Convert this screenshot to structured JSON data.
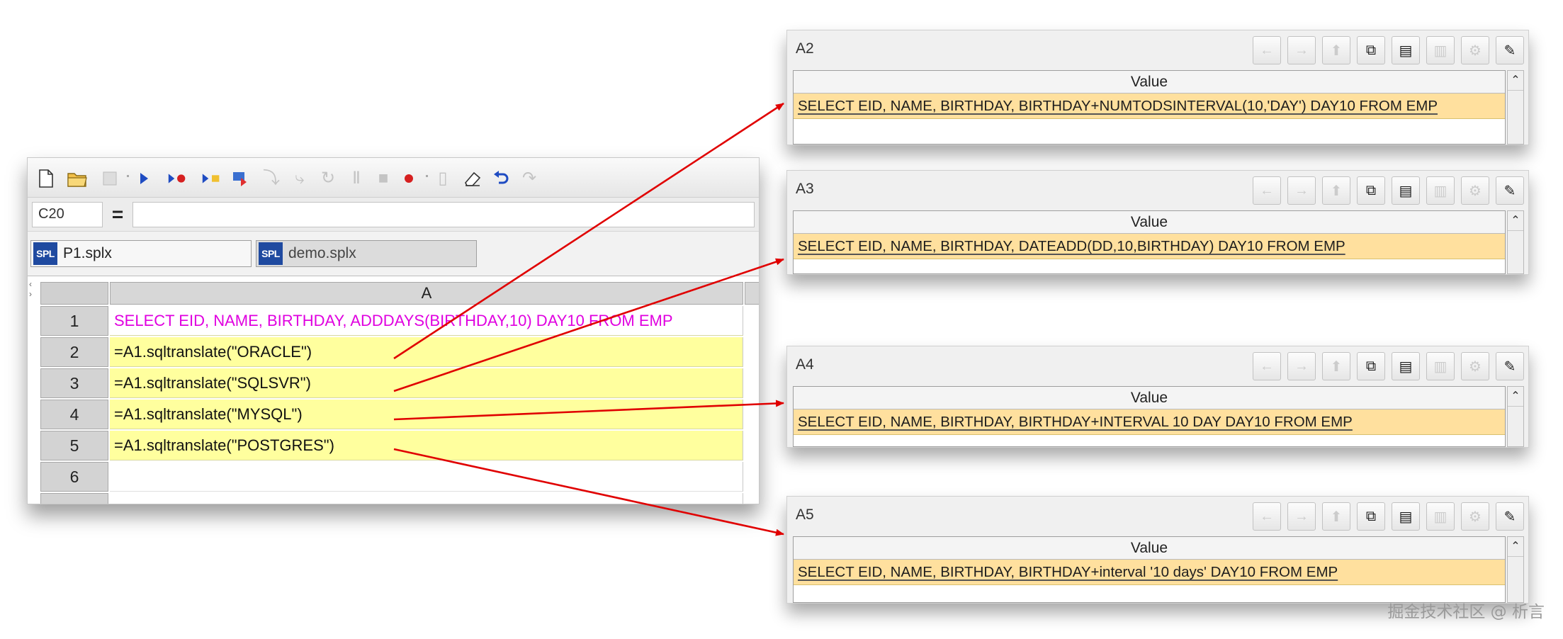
{
  "editor": {
    "cell_ref": "C20",
    "equal_sign": "=",
    "formula": "",
    "tabs": [
      {
        "badge": "SPL",
        "label": "P1.splx"
      },
      {
        "badge": "SPL",
        "label": "demo.splx"
      }
    ],
    "column_header": "A",
    "rows": [
      {
        "num": "1",
        "text": "SELECT EID, NAME, BIRTHDAY, ADDDAYS(BIRTHDAY,10) DAY10 FROM EMP"
      },
      {
        "num": "2",
        "text": "=A1.sqltranslate(\"ORACLE\")"
      },
      {
        "num": "3",
        "text": "=A1.sqltranslate(\"SQLSVR\")"
      },
      {
        "num": "4",
        "text": "=A1.sqltranslate(\"MYSQL\")"
      },
      {
        "num": "5",
        "text": "=A1.sqltranslate(\"POSTGRES\")"
      },
      {
        "num": "6",
        "text": ""
      }
    ]
  },
  "panels": [
    {
      "title": "A2",
      "header": "Value",
      "value": "SELECT EID, NAME, BIRTHDAY, BIRTHDAY+NUMTODSINTERVAL(10,'DAY') DAY10 FROM EMP"
    },
    {
      "title": "A3",
      "header": "Value",
      "value": "SELECT EID, NAME, BIRTHDAY, DATEADD(DD,10,BIRTHDAY) DAY10 FROM EMP"
    },
    {
      "title": "A4",
      "header": "Value",
      "value": "SELECT EID, NAME, BIRTHDAY, BIRTHDAY+INTERVAL 10 DAY DAY10 FROM EMP"
    },
    {
      "title": "A5",
      "header": "Value",
      "value": "SELECT EID, NAME, BIRTHDAY, BIRTHDAY+interval '10 days' DAY10 FROM EMP"
    }
  ],
  "watermark": "掘金技术社区 @ 析言",
  "colors": {
    "cell_yellow": "#ffff9e",
    "sql_magenta": "#e000e0",
    "value_highlight": "#ffe09e",
    "arrow_red": "#e00000",
    "spl_badge": "#1f4aa0"
  }
}
